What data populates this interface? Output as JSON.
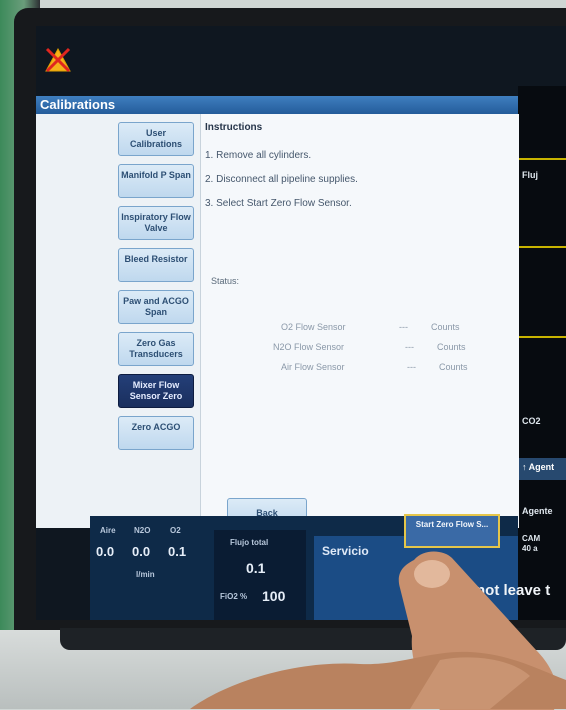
{
  "window": {
    "title": "Calibrations"
  },
  "nav": {
    "items": [
      {
        "label": "User Calibrations",
        "selected": false
      },
      {
        "label": "Manifold P Span",
        "selected": false
      },
      {
        "label": "Inspiratory Flow Valve",
        "selected": false
      },
      {
        "label": "Bleed Resistor",
        "selected": false
      },
      {
        "label": "Paw and ACGO Span",
        "selected": false
      },
      {
        "label": "Zero Gas Transducers",
        "selected": false
      },
      {
        "label": "Mixer Flow Sensor Zero",
        "selected": true
      },
      {
        "label": "Zero ACGO",
        "selected": false
      }
    ]
  },
  "instructions": {
    "title": "Instructions",
    "steps": [
      "1. Remove all cylinders.",
      "2. Disconnect all pipeline supplies.",
      "3. Select Start Zero Flow Sensor."
    ]
  },
  "status": {
    "label": "Status:",
    "sensors": [
      {
        "name": "O2 Flow Sensor",
        "value": "---",
        "unit": "Counts"
      },
      {
        "name": "N2O Flow Sensor",
        "value": "---",
        "unit": "Counts"
      },
      {
        "name": "Air Flow Sensor",
        "value": "---",
        "unit": "Counts"
      }
    ]
  },
  "buttons": {
    "back": "Back",
    "start": "Start Zero Flow S..."
  },
  "gases": {
    "labels": [
      "Aire",
      "N2O",
      "O2"
    ],
    "values": [
      "0.0",
      "0.0",
      "0.1"
    ],
    "unit": "l/min"
  },
  "flow_total": {
    "label": "Flujo total",
    "value": "0.1",
    "fio2_label": "FiO2 %",
    "fio2_value": "100"
  },
  "service": {
    "label": "Servicio"
  },
  "message": {
    "text": "not leave t"
  },
  "side_panel": {
    "flow_label": "Fluj",
    "co2_label": "CO2",
    "agent_button": "Agent",
    "agent_label": "Agente",
    "cam_label": "CAM",
    "cam_value": "40 a"
  },
  "colors": {
    "title_bar": "#245c9a",
    "selected_nav": "#1a2f5e",
    "start_border": "#e5c64a",
    "band": "#0e2a48"
  }
}
